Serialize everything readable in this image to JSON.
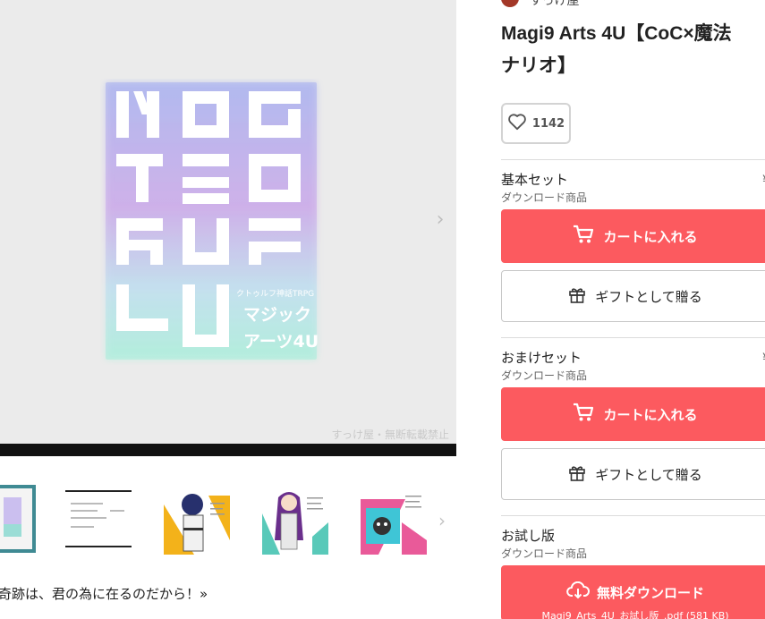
{
  "shop": {
    "name": "すっけ屋"
  },
  "product": {
    "title_line1": "Magi9 Arts 4U【CoC×魔法",
    "title_line2": "ナリオ】"
  },
  "likes": {
    "count": "1142"
  },
  "main_image": {
    "watermark": "すっけ屋・無断転載禁止",
    "logo_subtitle": "クトゥルフ神話TRPG",
    "logo_kana1": "マジック",
    "logo_kana2": "アーツ4U"
  },
  "variants": [
    {
      "name": "基本セット",
      "type": "ダウンロード商品",
      "cart_label": "カートに入れる",
      "gift_label": "ギフトとして贈る"
    },
    {
      "name": "おまけセット",
      "type": "ダウンロード商品",
      "cart_label": "カートに入れる",
      "gift_label": "ギフトとして贈る"
    },
    {
      "name": "お試し版",
      "type": "ダウンロード商品",
      "download_label": "無料ダウンロード",
      "file_info": "Magi9_Arts_4U_お試し版_.pdf (581 KB)"
    }
  ],
  "description": {
    "line": "奇跡は、君の為に在るのだから！»"
  },
  "colors": {
    "accent": "#fc5a5f",
    "thumb_active": "#3f8a93"
  },
  "icons": {
    "like": "heart-icon",
    "cart": "cart-icon",
    "gift": "gift-icon",
    "download": "cloud-download-icon",
    "next": "chevron-right-icon"
  }
}
